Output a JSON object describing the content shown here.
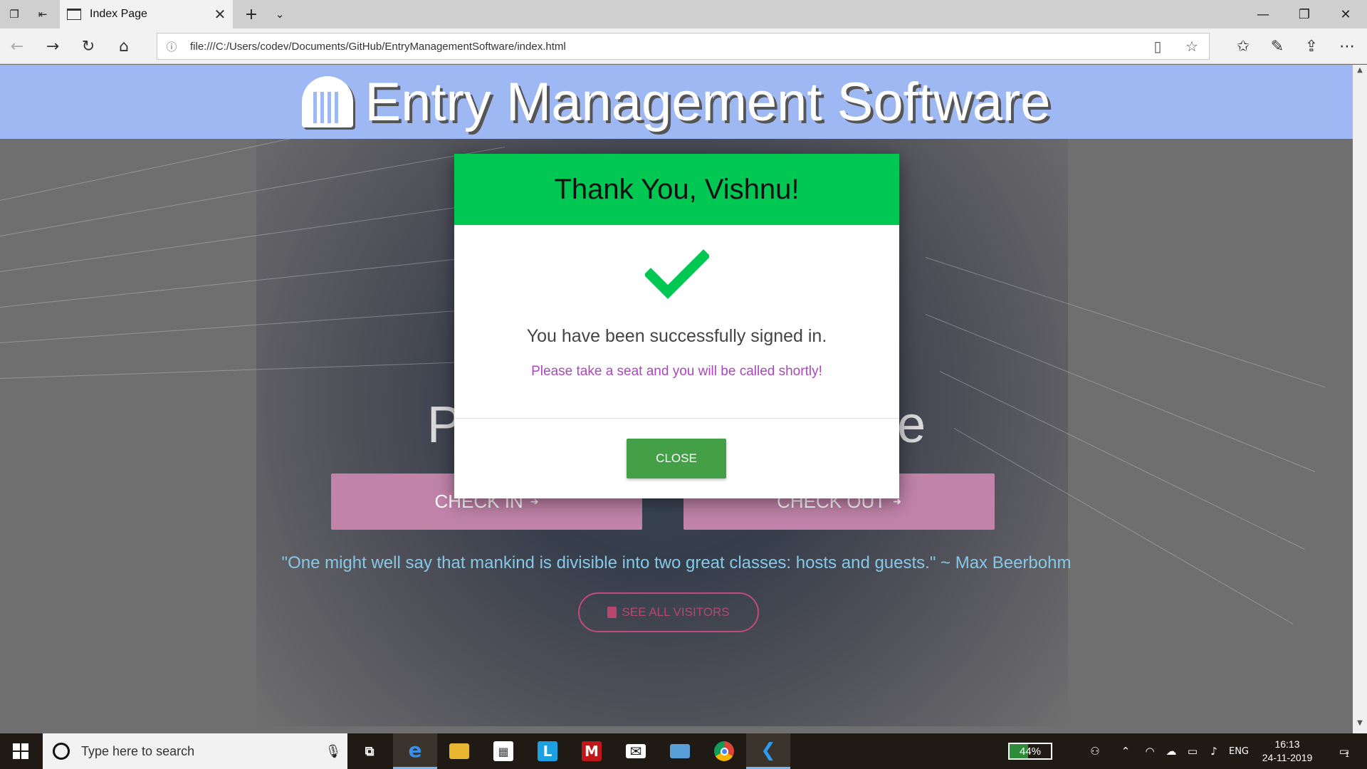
{
  "browser": {
    "tab_title": "Index Page",
    "address": "file:///C:/Users/codev/Documents/GitHub/EntryManagementSoftware/index.html"
  },
  "page": {
    "site_title": "Entry Management Software",
    "heading": "Please Check In Here",
    "check_in_label": "CHECK IN",
    "check_out_label": "CHECK OUT",
    "quote": "\"One might well say that mankind is divisible into two great classes: hosts and guests.\" ~ Max Beerbohm",
    "see_all_label": "SEE ALL VISITORS"
  },
  "modal": {
    "title": "Thank You, Vishnu!",
    "message": "You have been successfully signed in.",
    "submessage": "Please take a seat and you will be called shortly!",
    "close_label": "CLOSE",
    "header_color": "#00c853",
    "check_color": "#00c853",
    "close_color": "#43a047"
  },
  "taskbar": {
    "search_placeholder": "Type here to search",
    "battery": "44%",
    "battery_level": 0.44,
    "language": "ENG",
    "time": "16:13",
    "date": "24-11-2019",
    "notification_count": "1"
  }
}
